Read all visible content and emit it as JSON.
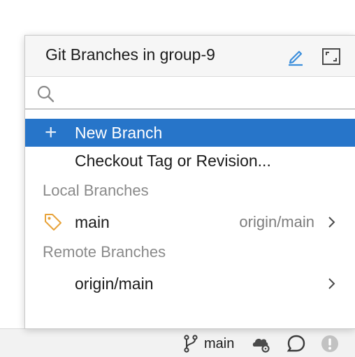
{
  "popup": {
    "title": "Git Branches in group-9",
    "search": {
      "placeholder": "",
      "value": ""
    },
    "actions": [
      {
        "label": "New Branch",
        "icon": "plus-icon",
        "selected": true
      },
      {
        "label": "Checkout Tag or Revision..."
      }
    ],
    "local_section": "Local Branches",
    "local_branches": [
      {
        "name": "main",
        "tracking": "origin/main",
        "icon": "tag-icon"
      }
    ],
    "remote_section": "Remote Branches",
    "remote_branches": [
      {
        "name": "origin/main"
      }
    ]
  },
  "statusbar": {
    "branch": "main"
  },
  "colors": {
    "selection": "#2775c9",
    "edit_icon": "#3d8fdc",
    "tag_icon": "#e8a33a"
  }
}
